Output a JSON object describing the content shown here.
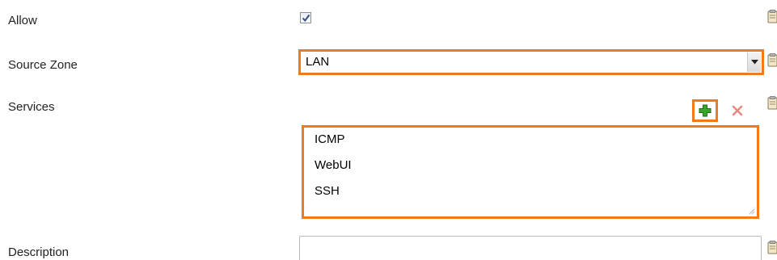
{
  "form": {
    "allow": {
      "label": "Allow",
      "checked": true
    },
    "source_zone": {
      "label": "Source Zone",
      "selected": "LAN"
    },
    "services": {
      "label": "Services",
      "items": [
        "ICMP",
        "WebUI",
        "SSH"
      ]
    },
    "description": {
      "label": "Description",
      "value": ""
    }
  },
  "colors": {
    "highlight": "#f07b1c",
    "add_icon": "#3aa52a",
    "remove_icon": "#e88a80"
  },
  "icons": {
    "side": "clipboard-icon",
    "add": "plus-icon",
    "remove": "x-icon",
    "dropdown": "chevron-down-icon"
  }
}
